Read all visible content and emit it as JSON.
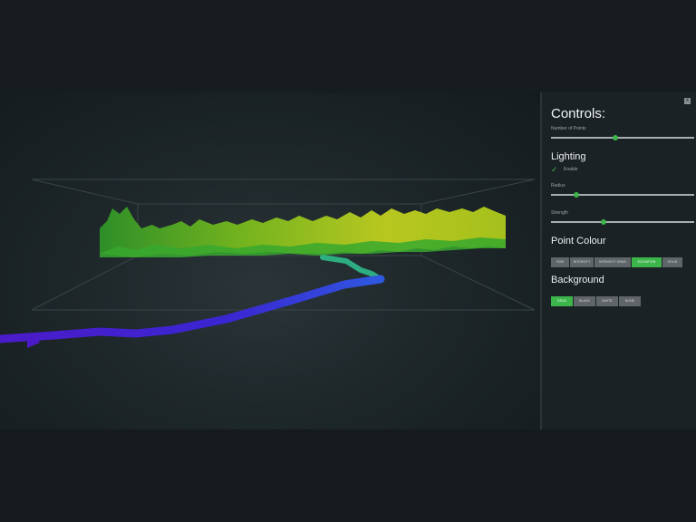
{
  "controls": {
    "title": "Controls:",
    "close_label": "x",
    "number_of_points_label": "Number of Points",
    "number_of_points_level": 0.45,
    "lighting": {
      "title": "Lighting",
      "enable_label": "Enable",
      "enabled": true,
      "radius_label": "Radius",
      "radius_level": 0.18,
      "strength_label": "Strength",
      "strength_level": 0.37
    },
    "point_colour": {
      "title": "Point Colour",
      "options": [
        "RGB",
        "INTENSITY",
        "INTENSITY GRAD",
        "ELEVATION",
        "SOLID"
      ],
      "selected": "ELEVATION"
    },
    "background": {
      "title": "Background",
      "options": [
        "GRAD",
        "BLACK",
        "WHITE",
        "NONE"
      ],
      "selected": "GRAD"
    }
  },
  "colors": {
    "accent": "#3cb54a",
    "button": "#5f6568",
    "panel": "#1b2225",
    "elevation_low": "#3a1fd6",
    "elevation_mid": "#2fc48f",
    "elevation_high": "#e4e82a"
  }
}
